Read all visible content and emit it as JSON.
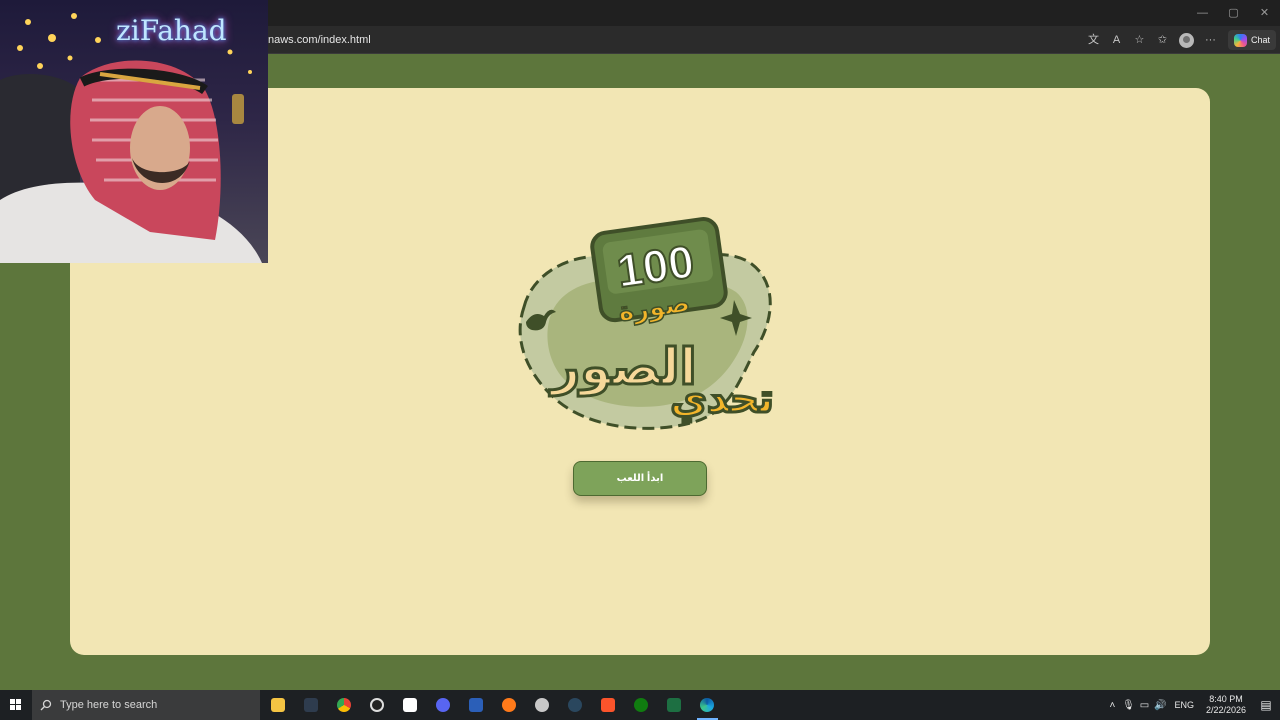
{
  "browser": {
    "address": "naws.com/index.html",
    "window_controls": [
      "—",
      "▢",
      "✕"
    ],
    "toolbar_icons": [
      "translate-icon",
      "read-aloud-icon",
      "favorite-star-icon",
      "favorites-icon",
      "profile-icon",
      "more-icon"
    ],
    "copilot_label": "Chat"
  },
  "page": {
    "logo": {
      "number": "100",
      "word_pictures": "صورة",
      "title_line1": "الصور",
      "title_line2": "تحدي"
    },
    "start_button": "ابدأ اللعب"
  },
  "webcam": {
    "name": "ziFahad"
  },
  "taskbar": {
    "search_placeholder": "Type here to search",
    "apps": [
      "file-explorer-icon",
      "terminal-icon",
      "chrome-icon",
      "obs-icon",
      "store-icon",
      "discord-icon",
      "word-icon",
      "firefox-icon",
      "game-icon",
      "steam-icon",
      "brave-icon",
      "xbox-icon",
      "excel-icon",
      "edge-icon"
    ],
    "language": "ENG",
    "time": "8:40 PM",
    "date": "2/22/2026"
  },
  "colors": {
    "page_background": "#5d763c",
    "card": "#f2e6b4",
    "button": "#7ea35a",
    "logo_green": "#5f7b3f",
    "logo_yellow": "#f3b52a"
  }
}
